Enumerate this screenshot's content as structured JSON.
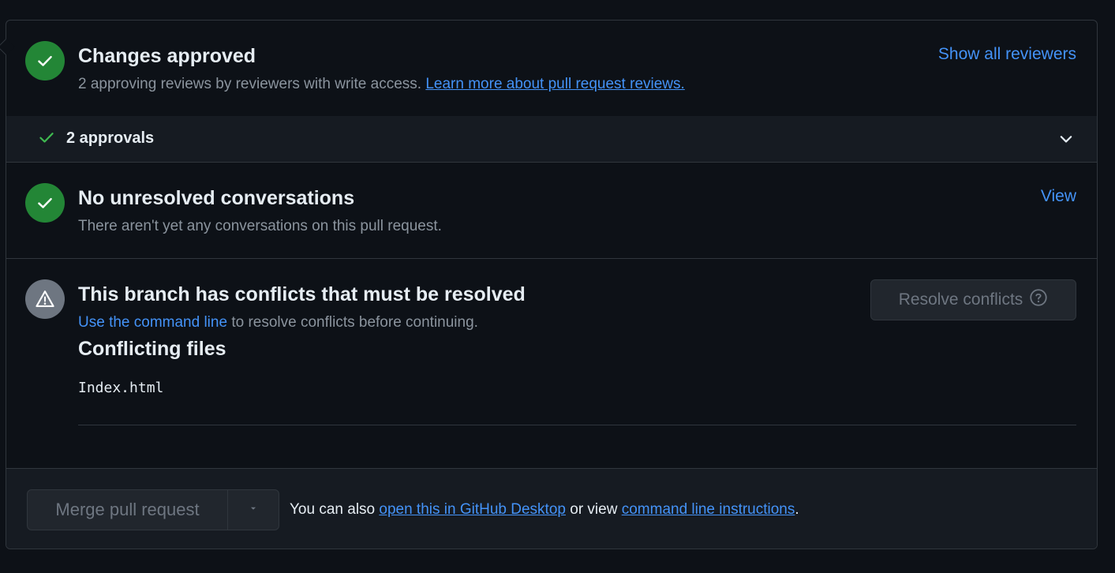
{
  "approval": {
    "title": "Changes approved",
    "desc": "2 approving reviews by reviewers with write access.",
    "learn_link": "Learn more about pull request reviews.",
    "show_reviewers": "Show all reviewers",
    "approvals_label": "2 approvals"
  },
  "conversations": {
    "title": "No unresolved conversations",
    "desc": "There aren't yet any conversations on this pull request.",
    "view_link": "View"
  },
  "conflicts": {
    "title": "This branch has conflicts that must be resolved",
    "cmd_link": "Use the command line",
    "desc_tail": " to resolve conflicts before continuing.",
    "files_heading": "Conflicting files",
    "files": [
      "Index.html"
    ],
    "resolve_button": "Resolve conflicts"
  },
  "merge": {
    "button": "Merge pull request",
    "text_before": "You can also ",
    "desktop_link": "open this in GitHub Desktop",
    "text_mid": " or view ",
    "cli_link": "command line instructions",
    "text_end": "."
  },
  "colors": {
    "background": "#0d1117",
    "success": "#238636",
    "link": "#4493f8",
    "muted": "#8b949e"
  }
}
